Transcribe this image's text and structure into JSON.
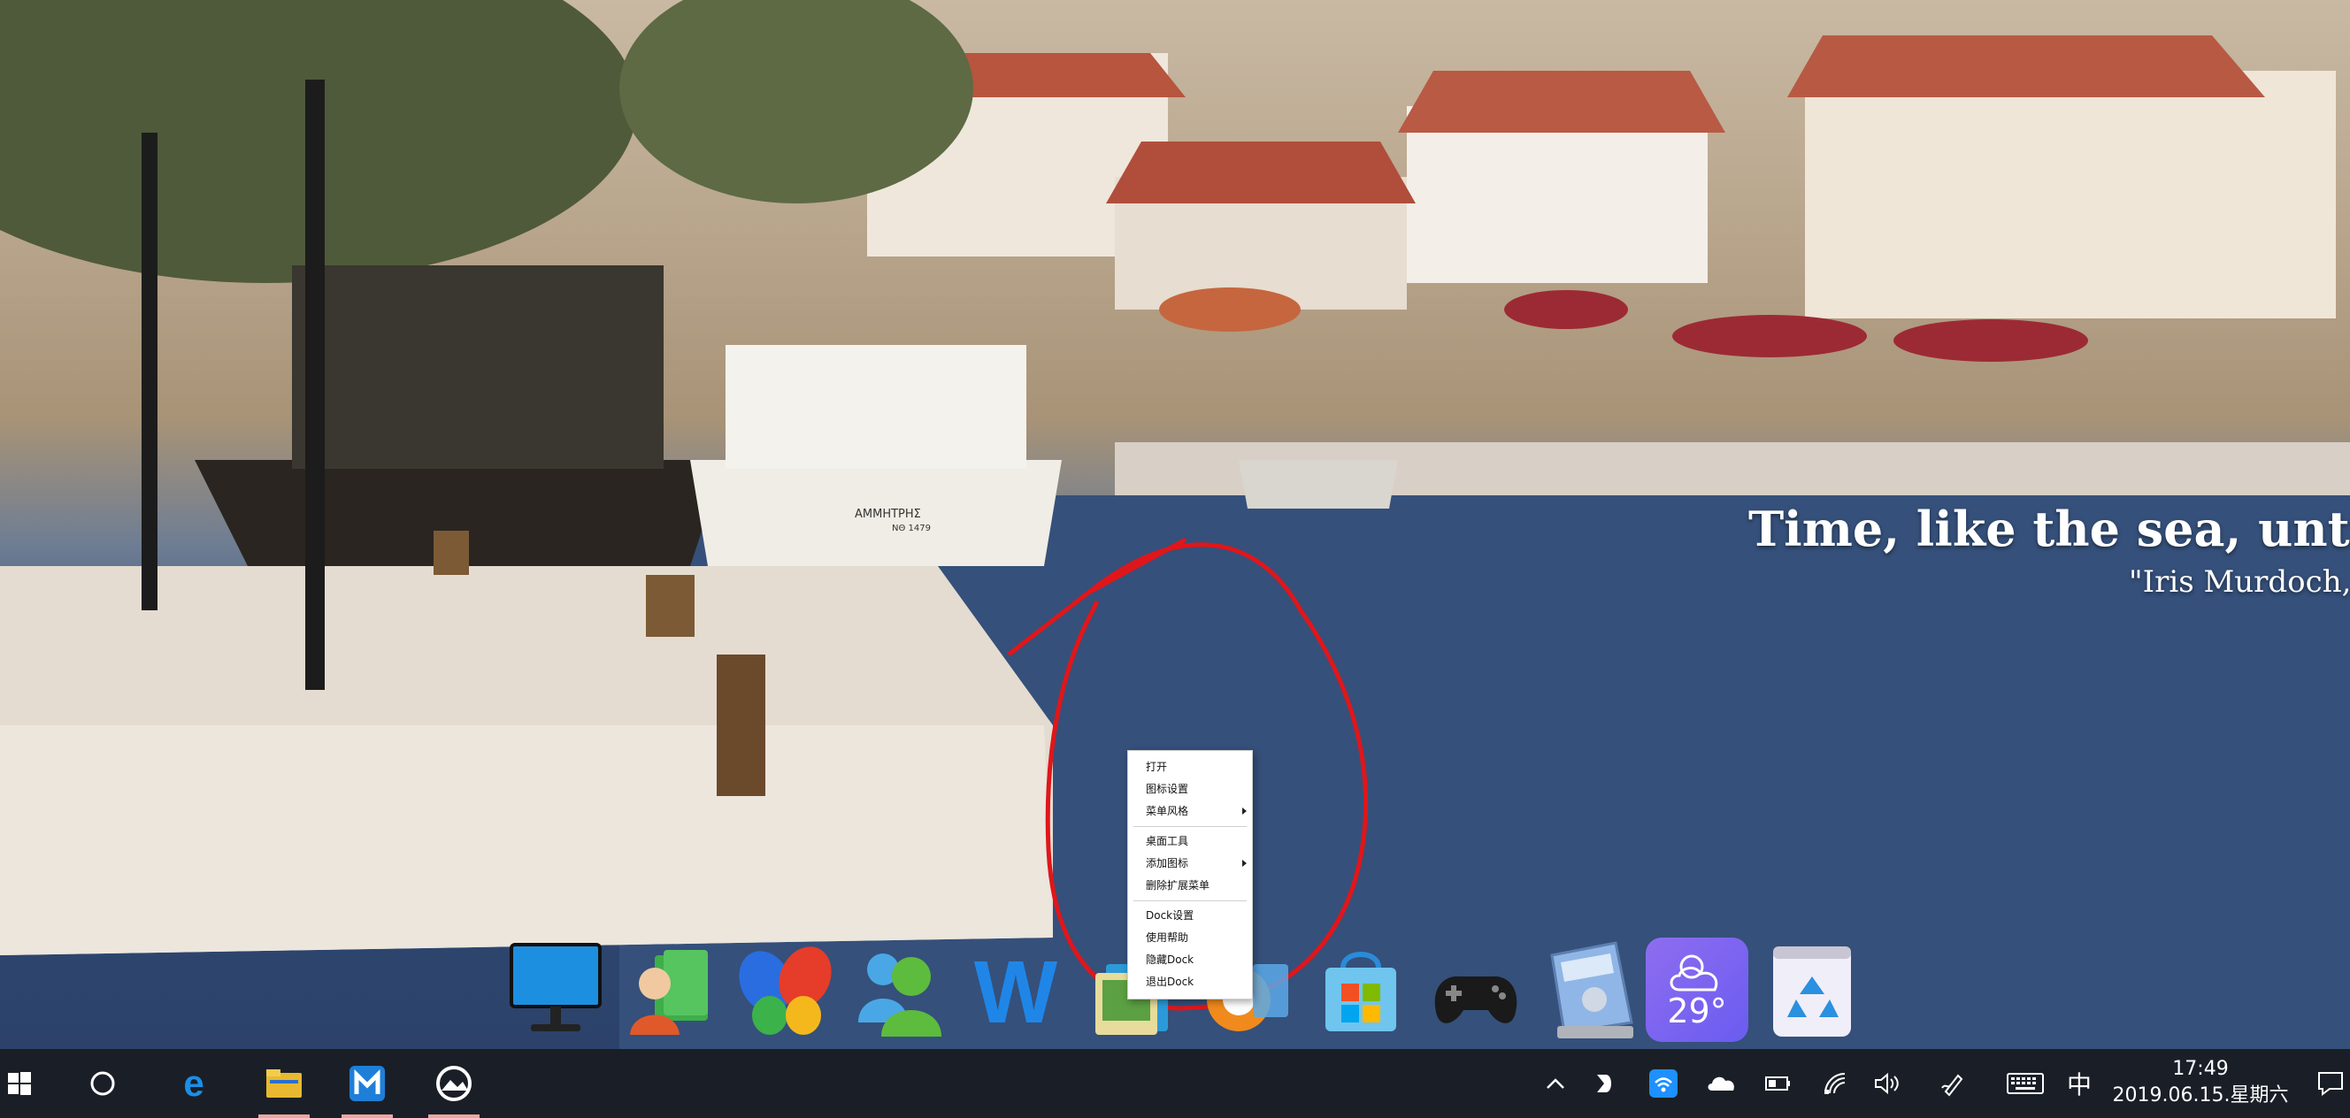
{
  "wallpaper": {
    "quote": "Time, like the sea, unties all no",
    "author": "\"Iris Murdoch, Se"
  },
  "boat_lettering": {
    "name": "ΑΜΜΗΤΡΗΣ",
    "reg": "ΝΘ 1479"
  },
  "context_menu": {
    "items": [
      {
        "label": "打开",
        "submenu": false
      },
      {
        "label": "图标设置",
        "submenu": false
      },
      {
        "label": "菜单风格",
        "submenu": true
      },
      {
        "separator": true
      },
      {
        "label": "桌面工具",
        "submenu": false
      },
      {
        "label": "添加图标",
        "submenu": true
      },
      {
        "label": "删除扩展菜单",
        "submenu": false
      },
      {
        "separator": true
      },
      {
        "label": "Dock设置",
        "submenu": false
      },
      {
        "label": "使用帮助",
        "submenu": false
      },
      {
        "label": "隐藏Dock",
        "submenu": false
      },
      {
        "label": "退出Dock",
        "submenu": false
      }
    ]
  },
  "dock": {
    "icons": [
      "monitor-icon",
      "contacts-icon",
      "msn-butterfly-icon",
      "messenger-icon",
      "word-icon",
      "photo-gallery-icon",
      "orange-app-icon",
      "store-bag-icon",
      "gamepad-icon",
      "calculator-icon",
      "weather-icon",
      "recycle-bin-icon"
    ],
    "weather_temp": "29°"
  },
  "taskbar": {
    "pinned": [
      "start-icon",
      "cortana-icon",
      "edge-icon",
      "file-explorer-icon",
      "maxthon-icon",
      "photos-icon"
    ],
    "ime": "中",
    "time": "17:49",
    "date": "2019.06.15.星期六"
  },
  "colors": {
    "taskbar_bg": "#1a1f27",
    "annotation_circle": "#e0161a",
    "wifi_highlight": "#1e90ff",
    "weather_tile": "#7b65f0"
  }
}
